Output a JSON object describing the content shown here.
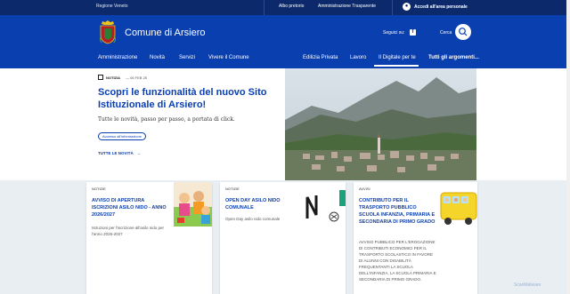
{
  "topbar": {
    "region": "Regione Veneto",
    "links": [
      "Albo pretorio",
      "Amministrazione Trasparente"
    ],
    "login": "Accedi all'area personale"
  },
  "header": {
    "city": "Comune di Arsiero",
    "follow": "Seguici su:",
    "search": "Cerca"
  },
  "nav": {
    "left": [
      "Amministrazione",
      "Novità",
      "Servizi",
      "Vivere il Comune"
    ],
    "right": [
      "Edilizia Privata",
      "Lavoro",
      "Il Digitale per te",
      "Tutti gli argomenti..."
    ]
  },
  "hero": {
    "category": "NOTIZIA",
    "date": "06 FEB 25",
    "title": "Scopri le funzionalità del nuovo Sito Istituzionale di Arsiero!",
    "subtitle": "Tutte le novità, passo per passo, a portata di click.",
    "tag": "Accesso all'informazione",
    "all_news": "TUTTE LE NOVITÀ"
  },
  "cards": [
    {
      "category": "NOTIZIE",
      "title": "AVVISO DI APERTURA ISCRIZIONI ASILO NIDO - ANNO 2026/2027",
      "desc": "Istruzioni per l'iscrizione all'asilo nido per l'anno 2026-2027"
    },
    {
      "category": "NOTIZIE",
      "title": "OPEN DAY ASILO NIDO COMUNALE",
      "desc": "Open Day asilo nido comunale"
    },
    {
      "category": "AVVISI",
      "title": "CONTRIBUTO PER IL TRASPORTO PUBBLICO SCUOLA INFANZIA, PRIMARIA E SECONDARIA DI PRIMO GRADO",
      "desc": "AVVISO PUBBLICO PER L'EROGAZIONE DI CONTRIBUTI ECONOMICI PER IL TRASPORTO SCOLASTICO IN FAVORE DI ALUNNI CON DISABILITÀ FREQUENTANTI LA SCUOLA DELL'INFANZIA, LA SCUOLA PRIMARIA E SECONDARIA DI PRIMO GRADO."
    }
  ],
  "watermark": "ScanMalware",
  "colors": {
    "primary": "#0a3fb0",
    "topbar": "#0c2a6b",
    "section_bg": "#e9eef3"
  }
}
